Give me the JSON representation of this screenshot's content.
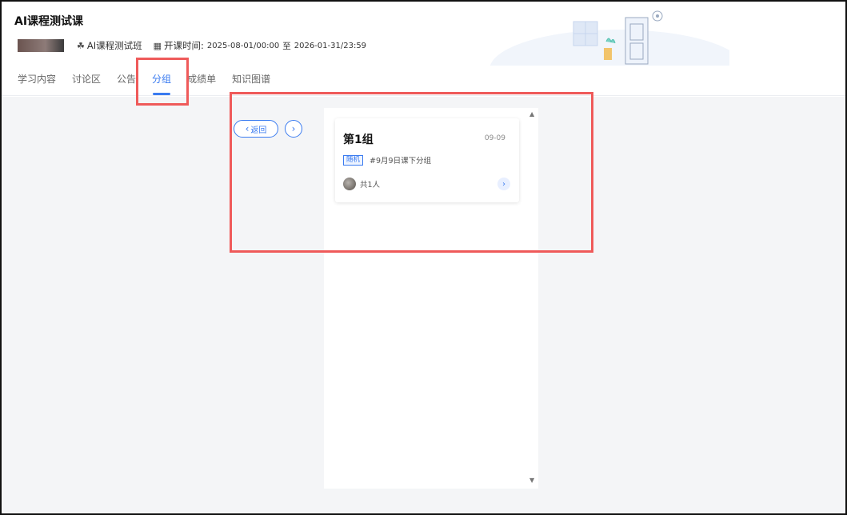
{
  "course": {
    "title": "AI课程测试课",
    "class_name": "AI课程测试班",
    "time_label": "开课时间:",
    "time_start": "2025-08-01/00:00",
    "time_sep": "至",
    "time_end": "2026-01-31/23:59"
  },
  "tabs": [
    {
      "label": "学习内容"
    },
    {
      "label": "讨论区"
    },
    {
      "label": "公告"
    },
    {
      "label": "分组"
    },
    {
      "label": "成绩单"
    },
    {
      "label": "知识图谱"
    }
  ],
  "nav": {
    "back_label": "返回"
  },
  "group_card": {
    "name": "第1组",
    "date": "09-09",
    "tag": "随机",
    "description": "#9月9日课下分组",
    "members": "共1人"
  },
  "colors": {
    "accent": "#3a7bf0",
    "highlight": "#ef5a5a",
    "content_bg": "#f4f5f7"
  },
  "icons": {
    "class_icon": "graduation-cap-icon",
    "calendar_icon": "calendar-icon",
    "back_chevron": "chevron-left-icon",
    "next_chevron": "chevron-right-icon",
    "scroll_up": "scroll-up-icon",
    "scroll_down": "scroll-down-icon"
  }
}
